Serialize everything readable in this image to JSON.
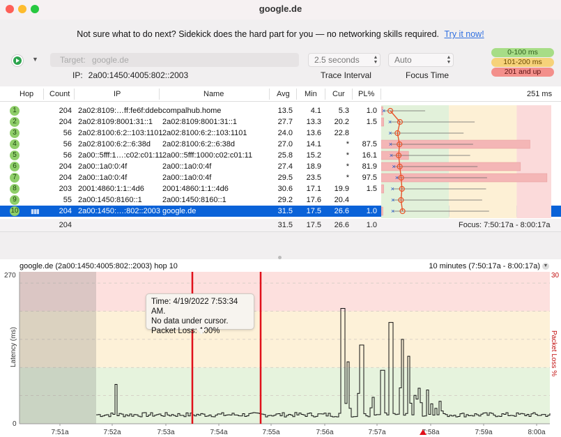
{
  "window": {
    "title": "google.de"
  },
  "promo": {
    "text": "Not sure what to do next? Sidekick does the hard part for you — no networking skills required.",
    "link": "Try it now!"
  },
  "toolbar": {
    "target_label": "Target:",
    "target_value": "google.de",
    "ip_label": "IP:",
    "ip_value": "2a00:1450:4005:802::2003",
    "interval_value": "2.5 seconds",
    "interval_label": "Trace Interval",
    "focus_value": "Auto",
    "focus_label": "Focus Time"
  },
  "legend": {
    "green": "0-100 ms",
    "yellow": "101-200 ms",
    "red": "201 and up"
  },
  "colors": {
    "green": "#a7dd87",
    "yellow": "#f6d27a",
    "red": "#f38f8b",
    "accent": "#0a62d8"
  },
  "table": {
    "headers": {
      "hop": "Hop",
      "count": "Count",
      "ip": "IP",
      "name": "Name",
      "avg": "Avg",
      "min": "Min",
      "cur": "Cur",
      "pl": "PL%",
      "scale": "251 ms"
    },
    "rows": [
      {
        "hop": "1",
        "count": "204",
        "ip": "2a02:8109:…ff:fe6f:ddeb",
        "name": "compalhub.home",
        "avg": "13.5",
        "min": "4.1",
        "cur": "5.3",
        "pl": "1.0"
      },
      {
        "hop": "2",
        "count": "204",
        "ip": "2a02:8109:8001:31::1",
        "name": "2a02:8109:8001:31::1",
        "avg": "27.7",
        "min": "13.3",
        "cur": "20.2",
        "pl": "1.5"
      },
      {
        "hop": "3",
        "count": "56",
        "ip": "2a02:8100:6:2::103:1101",
        "name": "2a02:8100:6:2::103:1101",
        "avg": "24.0",
        "min": "13.6",
        "cur": "22.8",
        "pl": ""
      },
      {
        "hop": "4",
        "count": "56",
        "ip": "2a02:8100:6:2::6:38d",
        "name": "2a02:8100:6:2::6:38d",
        "avg": "27.0",
        "min": "14.1",
        "cur": "*",
        "pl": "87.5"
      },
      {
        "hop": "5",
        "count": "56",
        "ip": "2a00::5fff:1…:c02:c01:11",
        "name": "2a00::5fff:1000:c02:c01:11",
        "avg": "25.8",
        "min": "15.2",
        "cur": "*",
        "pl": "16.1"
      },
      {
        "hop": "6",
        "count": "204",
        "ip": "2a00::1a0:0:4f",
        "name": "2a00::1a0:0:4f",
        "avg": "27.4",
        "min": "18.9",
        "cur": "*",
        "pl": "81.9"
      },
      {
        "hop": "7",
        "count": "204",
        "ip": "2a00::1a0:0:4f",
        "name": "2a00::1a0:0:4f",
        "avg": "29.5",
        "min": "23.5",
        "cur": "*",
        "pl": "97.5"
      },
      {
        "hop": "8",
        "count": "203",
        "ip": "2001:4860:1:1::4d6",
        "name": "2001:4860:1:1::4d6",
        "avg": "30.6",
        "min": "17.1",
        "cur": "19.9",
        "pl": "1.5"
      },
      {
        "hop": "9",
        "count": "55",
        "ip": "2a00:1450:8160::1",
        "name": "2a00:1450:8160::1",
        "avg": "29.2",
        "min": "17.6",
        "cur": "20.4",
        "pl": ""
      },
      {
        "hop": "10",
        "count": "204",
        "ip": "2a00:1450:…:802::2003",
        "name": "google.de",
        "avg": "31.5",
        "min": "17.5",
        "cur": "26.6",
        "pl": "1.0"
      }
    ],
    "summary": {
      "count": "204",
      "avg": "31.5",
      "min": "17.5",
      "cur": "26.6",
      "pl": "1.0",
      "focus": "Focus: 7:50:17a - 8:00:17a"
    }
  },
  "graph": {
    "title": "google.de (2a00:1450:4005:802::2003) hop 10",
    "range": "10 minutes (7:50:17a - 8:00:17a)",
    "y_max_label": "270",
    "y_min_label": "0",
    "pl_max_label": "30",
    "y_axis_label": "Latency (ms)",
    "pl_axis_label": "Packet Loss %",
    "x_ticks": [
      "7:51a",
      "7:52a",
      "7:53a",
      "7:54a",
      "7:55a",
      "7:56a",
      "7:57a",
      "7:58a",
      "7:59a",
      "8:00a"
    ],
    "tooltip": {
      "time": "Time: 4/19/2022 7:53:34 AM.",
      "line2": "No data under cursor.",
      "line3": "Packet Loss: 100%"
    }
  }
}
